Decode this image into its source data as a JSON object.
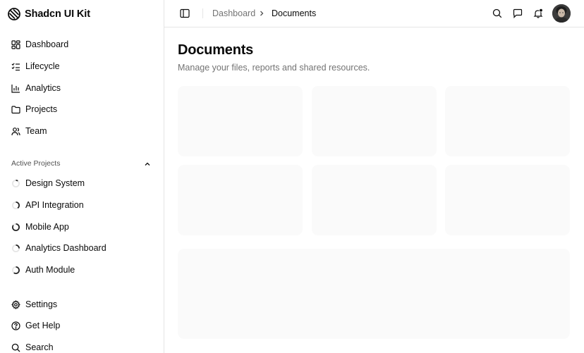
{
  "brand": {
    "name": "Shadcn UI Kit"
  },
  "sidebar": {
    "main_items": [
      {
        "label": "Dashboard",
        "icon": "layout-grid-icon"
      },
      {
        "label": "Lifecycle",
        "icon": "list-checks-icon"
      },
      {
        "label": "Analytics",
        "icon": "bar-chart-icon"
      },
      {
        "label": "Projects",
        "icon": "folder-icon"
      },
      {
        "label": "Team",
        "icon": "users-icon"
      }
    ],
    "group_label": "Active Projects",
    "projects": [
      {
        "label": "Design System",
        "progress": 0.1
      },
      {
        "label": "API Integration",
        "progress": 0.4
      },
      {
        "label": "Mobile App",
        "progress": 0.85
      },
      {
        "label": "Analytics Dashboard",
        "progress": 0.25
      },
      {
        "label": "Auth Module",
        "progress": 0.6
      }
    ],
    "footer_items": [
      {
        "label": "Settings",
        "icon": "gear-icon"
      },
      {
        "label": "Get Help",
        "icon": "help-circle-icon"
      },
      {
        "label": "Search",
        "icon": "search-icon"
      }
    ]
  },
  "breadcrumb": {
    "parent": "Dashboard",
    "current": "Documents"
  },
  "page": {
    "title": "Documents",
    "subtitle": "Manage your files, reports and shared resources."
  },
  "colors": {
    "card_bg": "#fafafa",
    "border": "#e5e5e5",
    "muted_text": "#737373",
    "notification_dot": "#0a0a0a"
  }
}
